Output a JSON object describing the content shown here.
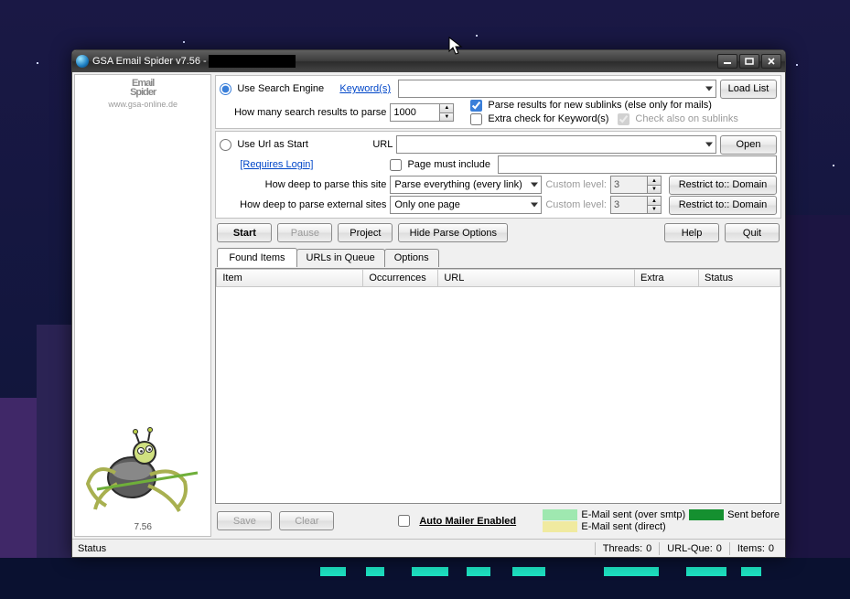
{
  "title": "GSA Email Spider v7.56 - ",
  "sidebar": {
    "logo_line1": "Email",
    "logo_line2": "Spider",
    "url": "www.gsa-online.de",
    "version": "7.56"
  },
  "searchEngine": {
    "radio_label": "Use Search Engine",
    "keyword_link": "Keyword(s)",
    "howmany_label": "How many search results to parse",
    "howmany_value": "1000",
    "parse_sublinks_label": "Parse results for new sublinks (else only for mails)",
    "extra_check_label": "Extra check for Keyword(s)",
    "check_sublinks_label": "Check also on sublinks",
    "loadlist_label": "Load List"
  },
  "urlStart": {
    "radio_label": "Use Url as Start",
    "url_label": "URL",
    "requires_login": "[Requires Login]",
    "open_label": "Open",
    "must_include_label": "Page must include",
    "deep_this_label": "How deep to parse this site",
    "deep_this_value": "Parse everything (every link)",
    "deep_ext_label": "How deep to parse external sites",
    "deep_ext_value": "Only one page",
    "custom_level_label": "Custom level:",
    "custom_level_value": "3",
    "restrict_label": "Restrict to:: Domain"
  },
  "buttons": {
    "start": "Start",
    "pause": "Pause",
    "project": "Project",
    "hide_parse": "Hide Parse Options",
    "help": "Help",
    "quit": "Quit",
    "save": "Save",
    "clear": "Clear"
  },
  "tabs": {
    "found": "Found Items",
    "queue": "URLs in Queue",
    "options": "Options"
  },
  "columns": {
    "item": "Item",
    "occ": "Occurrences",
    "url": "URL",
    "extra": "Extra",
    "status": "Status"
  },
  "auto_mailer_label": "Auto Mailer Enabled",
  "legend": {
    "smtp": "E-Mail sent (over smtp)",
    "before": "Sent before",
    "direct": "E-Mail sent (direct)"
  },
  "status": {
    "label": "Status",
    "threads_label": "Threads:",
    "threads_value": "0",
    "urlque_label": "URL-Que:",
    "urlque_value": "0",
    "items_label": "Items:",
    "items_value": "0"
  }
}
